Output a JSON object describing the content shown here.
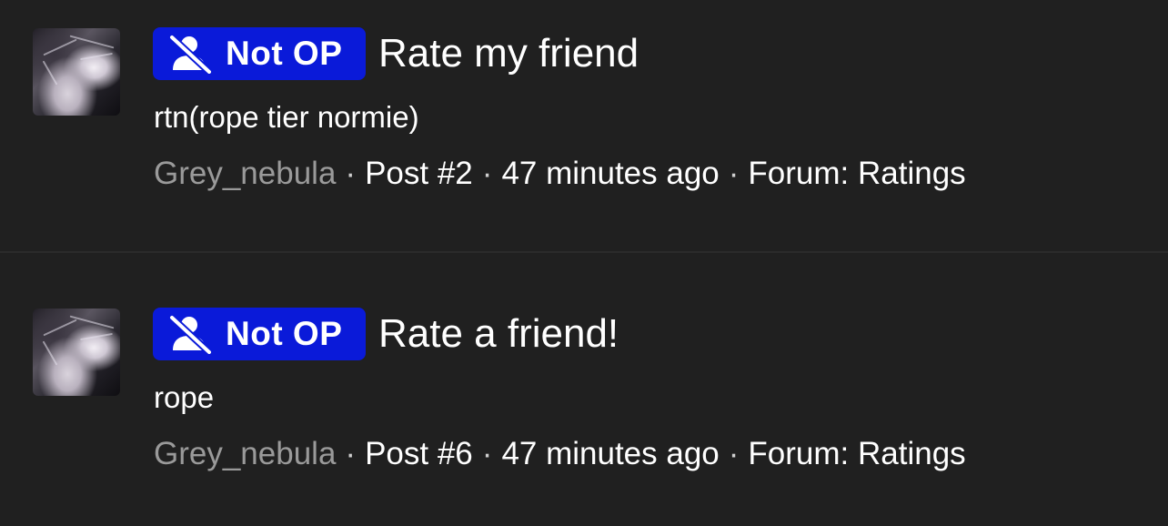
{
  "posts": [
    {
      "badge_label": "Not OP",
      "badge_icon": "user-slash-icon",
      "title": "Rate my friend",
      "body": "rtn(rope tier normie)",
      "author": "Grey_nebula",
      "post_number": "Post #2",
      "time": "47 minutes ago",
      "forum": "Forum: Ratings"
    },
    {
      "badge_label": "Not OP",
      "badge_icon": "user-slash-icon",
      "title": "Rate a friend!",
      "body": "rope",
      "author": "Grey_nebula",
      "post_number": "Post #6",
      "time": "47 minutes ago",
      "forum": "Forum: Ratings"
    }
  ],
  "colors": {
    "background": "#202020",
    "badge": "#0a1ad9",
    "author": "#9a9a9a",
    "text": "#ffffff"
  },
  "separator": "·"
}
